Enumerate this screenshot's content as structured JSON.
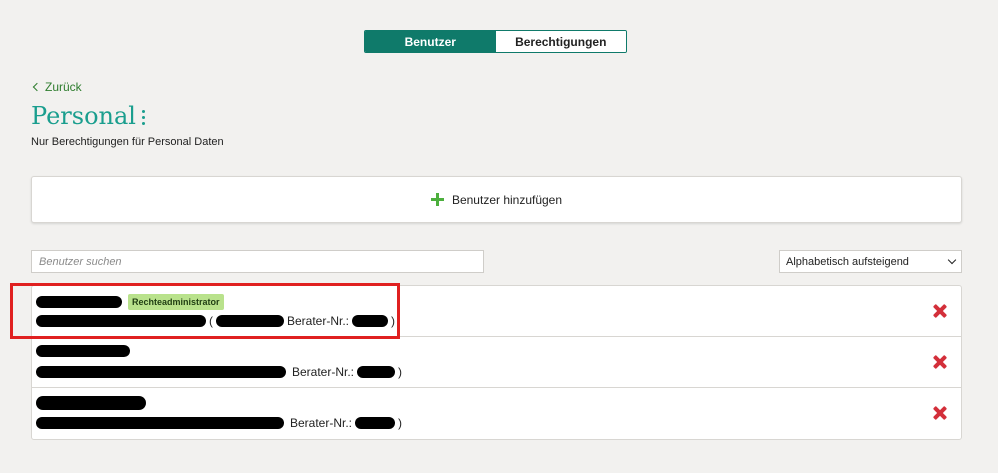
{
  "tabs": [
    {
      "label": "Benutzer",
      "active": true
    },
    {
      "label": "Berechtigungen",
      "active": false
    }
  ],
  "back_label": "Zurück",
  "page_title": "Personal",
  "page_subtitle": "Nur Berechtigungen für Personal Daten",
  "add_user_label": "Benutzer hinzufügen",
  "search": {
    "placeholder": "Benutzer suchen",
    "value": ""
  },
  "sort": {
    "selected": "Alphabetisch aufsteigend"
  },
  "users": [
    {
      "badge": "Rechteadministrator",
      "detail_prefix": "(",
      "consultant_label": "Berater-Nr.:",
      "detail_suffix": ")"
    },
    {
      "detail_prefix": "",
      "consultant_label": "Berater-Nr.:",
      "detail_suffix": ")"
    },
    {
      "detail_prefix": "",
      "consultant_label": "Berater-Nr.:",
      "detail_suffix": ")"
    }
  ],
  "colors": {
    "accent": "#0f7a6a",
    "title": "#1a9e8e",
    "back_link": "#2e7d2e",
    "add_icon": "#4caf3d",
    "badge_bg": "#b9e28c",
    "delete_icon": "#d32f3a",
    "highlight": "#e02020"
  },
  "icons": {
    "back": "chevron-left-icon",
    "menu": "kebab-menu-icon",
    "add": "plus-icon",
    "sort": "chevron-down-icon",
    "delete": "close-x-icon"
  }
}
